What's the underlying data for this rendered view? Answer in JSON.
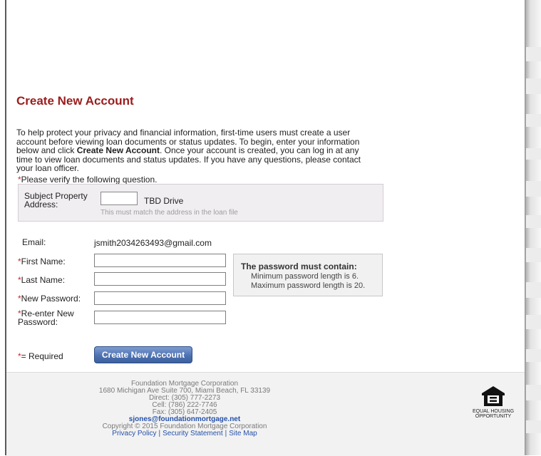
{
  "form": {
    "title": "Create New Account",
    "intro_part1": "To help protect your privacy and financial information, first-time users must create a user account before viewing loan documents or status updates. To begin, enter your information below and click ",
    "intro_bold": "Create New Account",
    "intro_part2": ". Once your account is created, you can log in at any time to view loan documents and status updates. If you have any questions, please contact your loan officer.",
    "required_marker": "*",
    "verify_label": "Please verify the following question.",
    "property_label": "Subject Property Address:",
    "property_input_value": "",
    "property_street": "TBD Drive",
    "property_hint": "This must match the address in the loan file",
    "email_label": "Email:",
    "email_value": "jsmith2034263493@gmail.com",
    "first_name_label": "First Name:",
    "last_name_label": "Last Name:",
    "new_password_label": "New Password:",
    "reenter_password_label": "Re-enter New Password:",
    "first_name_value": "",
    "last_name_value": "",
    "new_password_value": "",
    "reenter_password_value": "",
    "password_rules_title": "The password must contain:",
    "password_rule_min": "Minimum password length is 6.",
    "password_rule_max": "Maximum password length is 20.",
    "required_note": "= Required",
    "submit_label": "Create New Account"
  },
  "footer": {
    "company": "Foundation Mortgage Corporation",
    "address": "1680 Michigan Ave Suite 700, Miami Beach, FL  33139",
    "direct": "Direct:  (305) 777-2273",
    "cell": "Cell:  (786) 222-7746",
    "fax": "Fax:  (305) 647-2405",
    "email": "sjones@foundationmortgage.net",
    "copyright": "Copyright © 2015 Foundation Mortgage Corporation",
    "links": [
      "Privacy Policy",
      "Security Statement",
      "Site Map"
    ],
    "eho_line1": "EQUAL HOUSING",
    "eho_line2": "OPPORTUNITY"
  },
  "colors": {
    "title": "#9b1c1c",
    "required": "#c62828",
    "button": "#4e72b2",
    "link": "#2450a8"
  }
}
